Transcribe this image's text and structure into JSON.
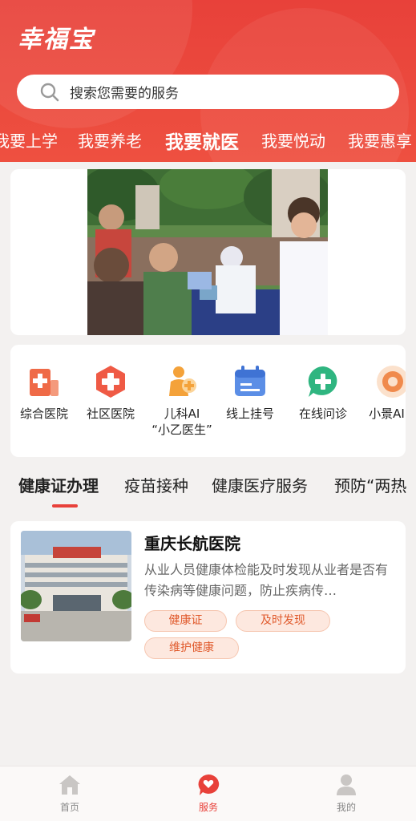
{
  "app": {
    "title": "幸福宝"
  },
  "search": {
    "placeholder": "搜索您需要的服务"
  },
  "category_tabs": [
    {
      "label": "我要上学",
      "active": false
    },
    {
      "label": "我要养老",
      "active": false
    },
    {
      "label": "我要就医",
      "active": true
    },
    {
      "label": "我要悦动",
      "active": false
    },
    {
      "label": "我要惠享",
      "active": false
    }
  ],
  "services": [
    {
      "label": "综合医院",
      "label2": "",
      "icon": "hospital-building-icon",
      "color": "#ef6a47"
    },
    {
      "label": "社区医院",
      "label2": "",
      "icon": "medical-cross-icon",
      "color": "#ef5a45"
    },
    {
      "label": "儿科AI",
      "label2": "“小乙医生”",
      "icon": "pediatric-doctor-icon",
      "color": "#f4a23a"
    },
    {
      "label": "线上挂号",
      "label2": "",
      "icon": "calendar-icon",
      "color": "#5b8ee6"
    },
    {
      "label": "在线问诊",
      "label2": "",
      "icon": "chat-plus-icon",
      "color": "#2fb580"
    },
    {
      "label": "小景AI医",
      "label2": "",
      "icon": "ai-badge-icon",
      "color": "#f08a4c"
    }
  ],
  "section_tabs": [
    {
      "label": "健康证办理",
      "active": true
    },
    {
      "label": "疫苗接种",
      "active": false
    },
    {
      "label": "健康医疗服务",
      "active": false
    },
    {
      "label": "预防“两热",
      "active": false
    }
  ],
  "hospital": {
    "name": "重庆长航医院",
    "description": "从业人员健康体检能及时发现从业者是否有传染病等健康问题，防止疾病传…",
    "tags": [
      "健康证",
      "及时发现",
      "维护健康"
    ]
  },
  "bottom_nav": [
    {
      "label": "首页",
      "icon": "home-icon",
      "active": false
    },
    {
      "label": "服务",
      "icon": "service-chat-icon",
      "active": true
    },
    {
      "label": "我的",
      "icon": "user-icon",
      "active": false
    }
  ],
  "colors": {
    "brand": "#e8413a",
    "tag_text": "#e05a2c"
  }
}
